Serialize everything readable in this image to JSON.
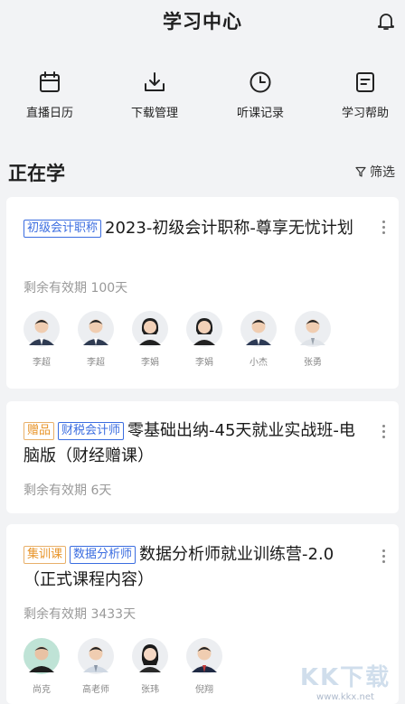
{
  "header": {
    "title": "学习中心",
    "bell_icon": "bell-icon"
  },
  "quick_actions": [
    {
      "label": "直播日历",
      "icon": "calendar-icon"
    },
    {
      "label": "下载管理",
      "icon": "download-icon"
    },
    {
      "label": "听课记录",
      "icon": "clock-icon"
    },
    {
      "label": "学习帮助",
      "icon": "document-icon"
    }
  ],
  "section": {
    "title": "正在学",
    "filter_label": "筛选"
  },
  "courses": [
    {
      "tags": [
        {
          "text": "初级会计职称",
          "style": "blue"
        }
      ],
      "title": "2023-初级会计职称-尊享无忧计划",
      "validity": "剩余有效期 100天",
      "teachers": [
        "李超",
        "李超",
        "李娟",
        "李娟",
        "小杰",
        "张勇"
      ]
    },
    {
      "tags": [
        {
          "text": "赠品",
          "style": "orange"
        },
        {
          "text": "财税会计师",
          "style": "blue"
        }
      ],
      "title": "零基础出纳-45天就业实战班-电脑版（财经赠课）",
      "validity": "剩余有效期 6天",
      "teachers": []
    },
    {
      "tags": [
        {
          "text": "集训课",
          "style": "orange"
        },
        {
          "text": "数据分析师",
          "style": "blue"
        }
      ],
      "title": "数据分析师就业训练营-2.0（正式课程内容）",
      "validity": "剩余有效期 3433天",
      "teachers": [
        "尚克",
        "高老师",
        "张玮",
        "倪翔"
      ]
    }
  ],
  "watermark": {
    "big": "KK下载",
    "small": "www.kkx.net"
  },
  "colors": {
    "tag_blue": "#3b6de0",
    "tag_orange": "#e8952b",
    "background": "#f2f3f5"
  }
}
